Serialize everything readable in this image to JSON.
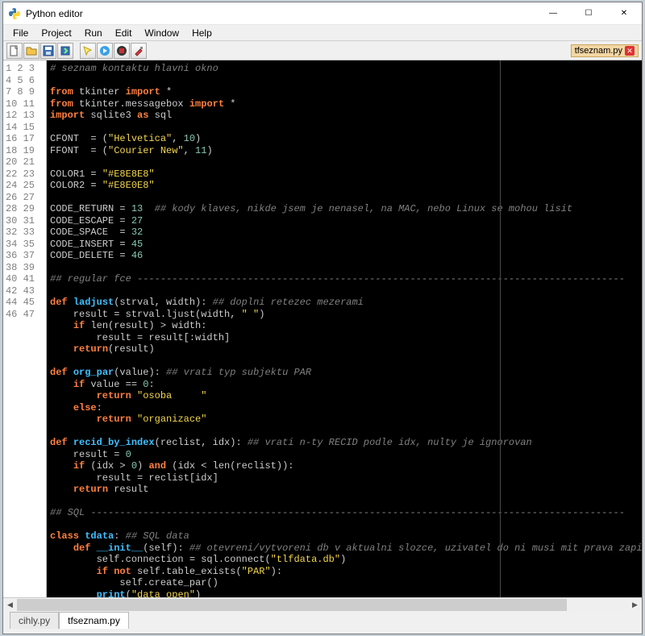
{
  "window": {
    "title": "Python editor",
    "minimize": "—",
    "maximize": "☐",
    "close": "✕"
  },
  "menu": {
    "file": "File",
    "project": "Project",
    "run": "Run",
    "edit": "Edit",
    "window": "Window",
    "help": "Help"
  },
  "toolbar": {
    "open_file": "tfseznam.py",
    "close_x": "✕"
  },
  "gutter": {
    "lines": [
      "1",
      "2",
      "3",
      "4",
      "5",
      "6",
      "7",
      "8",
      "9",
      "10",
      "11",
      "12",
      "13",
      "14",
      "15",
      "16",
      "17",
      "18",
      "19",
      "20",
      "21",
      "22",
      "23",
      "24",
      "25",
      "26",
      "27",
      "28",
      "29",
      "30",
      "31",
      "32",
      "33",
      "34",
      "35",
      "36",
      "37",
      "38",
      "39",
      "40",
      "41",
      "42",
      "43",
      "44",
      "45",
      "46",
      "47"
    ]
  },
  "code": {
    "l1": "# seznam kontaktu hlavni okno",
    "l3a": "from",
    "l3b": " tkinter ",
    "l3c": "import",
    "l3d": " *",
    "l4a": "from",
    "l4b": " tkinter.messagebox ",
    "l4c": "import",
    "l4d": " *",
    "l5a": "import",
    "l5b": " sqlite3 ",
    "l5c": "as",
    "l5d": " sql",
    "l7a": "CFONT  = (",
    "l7b": "\"Helvetica\"",
    "l7c": ", ",
    "l7d": "10",
    "l7e": ")",
    "l8a": "FFONT  = (",
    "l8b": "\"Courier New\"",
    "l8c": ", ",
    "l8d": "11",
    "l8e": ")",
    "l10a": "COLOR1 = ",
    "l10b": "\"#E8E8E8\"",
    "l11a": "COLOR2 = ",
    "l11b": "\"#E8E0E8\"",
    "l13a": "CODE_RETURN = ",
    "l13b": "13",
    "l13c": "  ",
    "l13d": "## kody klaves, nikde jsem je nenasel, na MAC, nebo Linux se mohou lisit",
    "l14a": "CODE_ESCAPE = ",
    "l14b": "27",
    "l15a": "CODE_SPACE  = ",
    "l15b": "32",
    "l16a": "CODE_INSERT = ",
    "l16b": "45",
    "l17a": "CODE_DELETE = ",
    "l17b": "46",
    "l19": "## regular fce ------------------------------------------------------------------------------------",
    "l21a": "def",
    "l21b": " ",
    "l21c": "ladjust",
    "l21d": "(strval, width): ",
    "l21e": "## doplni retezec mezerami",
    "l22a": "    result = strval.ljust(width, ",
    "l22b": "\" \"",
    "l22c": ")",
    "l23a": "    ",
    "l23b": "if",
    "l23c": " len(result) > width:",
    "l24": "        result = result[:width]",
    "l25a": "    ",
    "l25b": "return",
    "l25c": "(result)",
    "l27a": "def",
    "l27b": " ",
    "l27c": "org_par",
    "l27d": "(value): ",
    "l27e": "## vrati typ subjektu PAR",
    "l28a": "    ",
    "l28b": "if",
    "l28c": " value == ",
    "l28d": "0",
    "l28e": ":",
    "l29a": "        ",
    "l29b": "return",
    "l29c": " ",
    "l29d": "\"osoba     \"",
    "l30a": "    ",
    "l30b": "else",
    "l30c": ":",
    "l31a": "        ",
    "l31b": "return",
    "l31c": " ",
    "l31d": "\"organizace\"",
    "l33a": "def",
    "l33b": " ",
    "l33c": "recid_by_index",
    "l33d": "(reclist, idx): ",
    "l33e": "## vrati n-ty RECID podle idx, nulty je ignorovan",
    "l34a": "    result = ",
    "l34b": "0",
    "l35a": "    ",
    "l35b": "if",
    "l35c": " (idx > ",
    "l35d": "0",
    "l35e": ") ",
    "l35f": "and",
    "l35g": " (idx < len(reclist)):",
    "l36": "        result = reclist[idx]",
    "l37a": "    ",
    "l37b": "return",
    "l37c": " result",
    "l39": "## SQL --------------------------------------------------------------------------------------------",
    "l41a": "class",
    "l41b": " ",
    "l41c": "tdata",
    "l41d": ": ",
    "l41e": "## SQL data",
    "l42a": "    ",
    "l42b": "def",
    "l42c": " ",
    "l42d": "__init__",
    "l42e": "(self): ",
    "l42f": "## otevreni/vytvoreni db v aktualni slozce, uzivatel do ni musi mit prava zapisu",
    "l43a": "        self.connection = sql.connect(",
    "l43b": "\"tlfdata.db\"",
    "l43c": ")",
    "l44a": "        ",
    "l44b": "if",
    "l44c": " ",
    "l44d": "not",
    "l44e": " self.table_exists(",
    "l44f": "\"PAR\"",
    "l44g": "):",
    "l45": "            self.create_par()",
    "l46a": "        ",
    "l46b": "print",
    "l46c": "(",
    "l46d": "\"data open\"",
    "l46e": ")"
  },
  "tabs": {
    "inactive": "cihly.py",
    "active": "tfseznam.py"
  },
  "scroll": {
    "left": "◀",
    "right": "▶"
  }
}
